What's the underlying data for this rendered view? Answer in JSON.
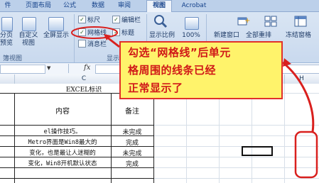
{
  "tabs": [
    "件",
    "页面布局",
    "公式",
    "数据",
    "审阅",
    "视图",
    "Acrobat"
  ],
  "active_tab_index": 5,
  "ribbon": {
    "view_buttons": [
      "分页\n预览",
      "自定义\n视图",
      "全屏显示"
    ],
    "workbook_views_group": "簿视图",
    "show_hide_group": "显示/隐藏",
    "checkboxes": [
      {
        "label": "标尺",
        "checked": true
      },
      {
        "label": "网格线",
        "checked": true
      },
      {
        "label": "消息栏",
        "checked": false
      },
      {
        "label": "编辑栏",
        "checked": true
      },
      {
        "label": "标题",
        "checked": true
      }
    ],
    "zoom_labels": [
      "显示比例",
      "100%"
    ],
    "window_buttons": [
      "新建窗口",
      "全部重排",
      "冻结窗格"
    ]
  },
  "formula_bar": {
    "fx": "fx"
  },
  "columns": [
    "",
    "C",
    "D",
    "E",
    "F",
    "G",
    "H"
  ],
  "sheet": {
    "title": "EXCEL标识",
    "headers": [
      "内容",
      "备注"
    ],
    "rows": [
      [
        "el操作技巧。",
        "未完成"
      ],
      [
        "Metro界面是Win8最大的",
        "完成"
      ],
      [
        "变化，也是最让人迷糊的",
        "未完成"
      ],
      [
        "变化，Win8开机默认状态",
        "完成"
      ]
    ]
  },
  "callout": {
    "lines": [
      "勾选“网格线”后单元",
      "格周围的线条已经",
      "正常显示了"
    ]
  },
  "colors": {
    "callout_bg": "#fff36b",
    "callout_border": "#e1302b",
    "callout_text": "#d01818",
    "arrow": "#d9201e"
  }
}
